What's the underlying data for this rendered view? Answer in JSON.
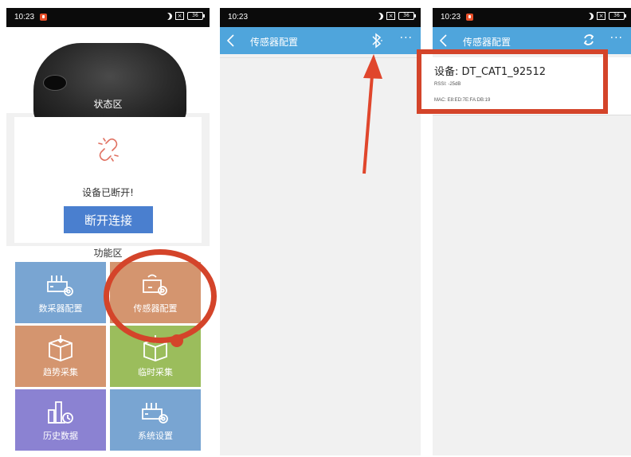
{
  "statusbar": {
    "time": "10:23",
    "battery": "36"
  },
  "phone1": {
    "status_area_label": "状态区",
    "connection_message": "设备已断开!",
    "disconnect_button": "断开连接",
    "function_area_title": "功能区",
    "tiles": [
      {
        "label": "数采器配置",
        "icon": "gateway-gear-icon",
        "color": "#79a5d2"
      },
      {
        "label": "传感器配置",
        "icon": "sensor-gear-icon",
        "color": "#d4956f"
      },
      {
        "label": "趋势采集",
        "icon": "box-download-icon",
        "color": "#d4956f"
      },
      {
        "label": "临时采集",
        "icon": "box-download-icon",
        "color": "#9bbd5c"
      },
      {
        "label": "历史数据",
        "icon": "chart-clock-icon",
        "color": "#8b82d2"
      },
      {
        "label": "系统设置",
        "icon": "gateway-gear-icon",
        "color": "#79a5d2"
      }
    ]
  },
  "phone2": {
    "title": "传感器配置",
    "more": "···"
  },
  "phone3": {
    "title": "传感器配置",
    "more": "···",
    "device": {
      "name": "设备: DT_CAT1_92512",
      "rssi": "RSSI: -25dB",
      "mac": "MAC: E8:ED:7E:FA:DB:19"
    }
  },
  "colors": {
    "appbar": "#4fa5dc",
    "highlight": "#d4442a",
    "button": "#4a7fcf"
  }
}
